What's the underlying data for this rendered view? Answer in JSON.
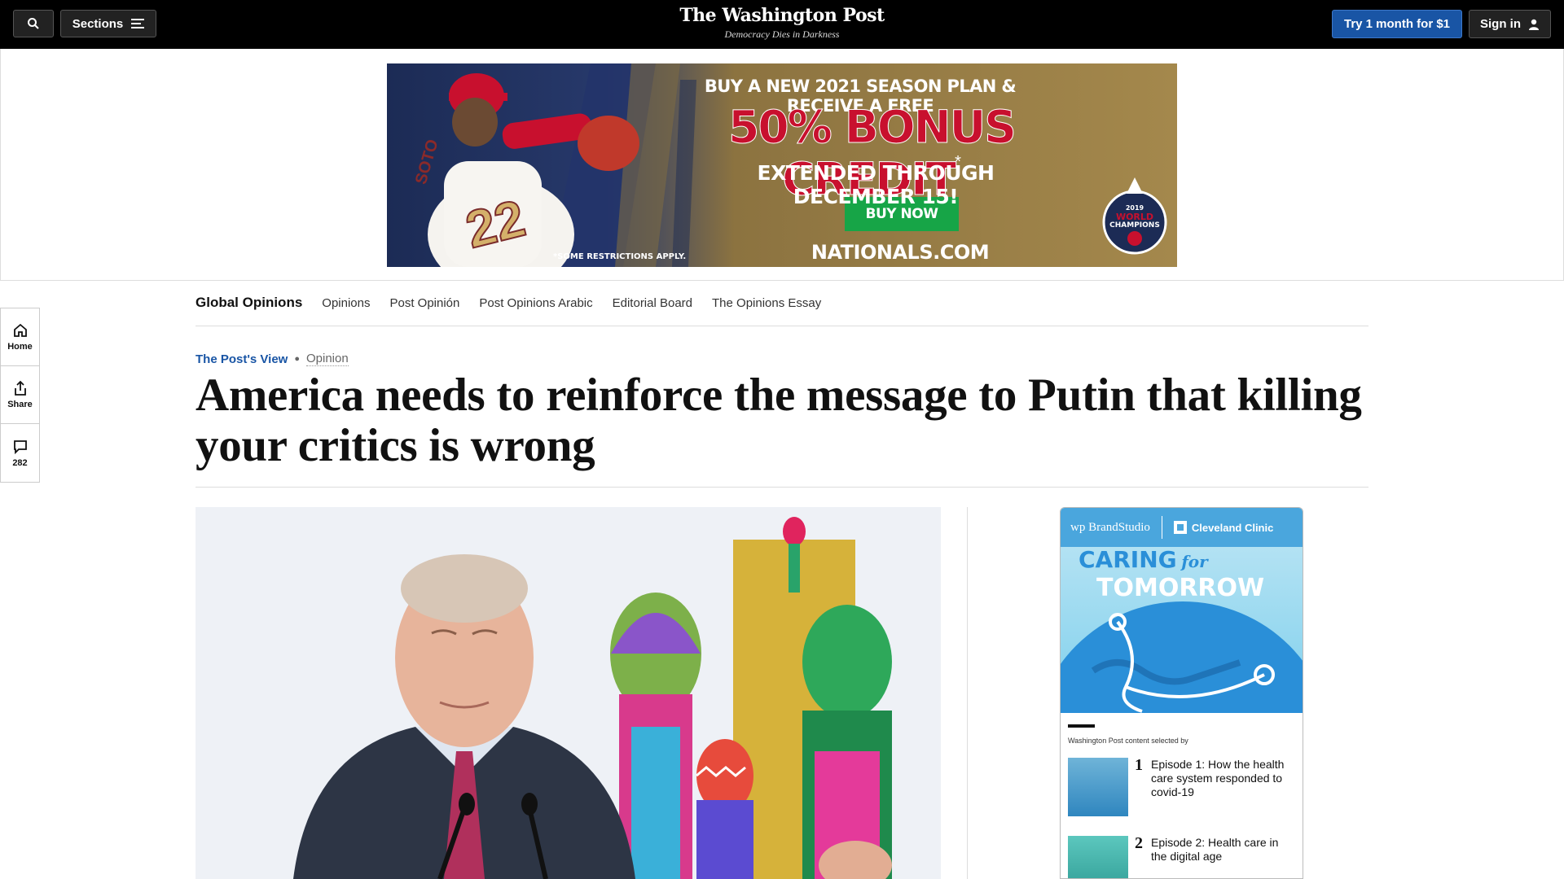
{
  "header": {
    "search_label": "",
    "sections_label": "Sections",
    "logo_name": "The Washington Post",
    "logo_tagline": "Democracy Dies in Darkness",
    "try_label": "Try 1 month for $1",
    "signin_label": "Sign in"
  },
  "ad": {
    "line1": "BUY A NEW 2021 SEASON PLAN & RECEIVE A FREE",
    "line2": "50% BONUS CREDIT",
    "line2_mark": "*",
    "line3": "EXTENDED THROUGH DECEMBER 15!",
    "cta": "BUY NOW",
    "site": "NATIONALS.COM",
    "fine": "*SOME RESTRICTIONS APPLY.",
    "jersey_name": "SOTO",
    "jersey_number": "22",
    "badge_year": "2019",
    "badge_line1": "WORLD",
    "badge_line2": "CHAMPIONS",
    "colors": {
      "navy": "#1c2b55",
      "gold": "#a4884c",
      "red": "#c8102e",
      "green": "#17a547"
    }
  },
  "subnav": {
    "items": [
      "Global Opinions",
      "Opinions",
      "Post Opinión",
      "Post Opinions Arabic",
      "Editorial Board",
      "The Opinions Essay"
    ]
  },
  "rail": {
    "home_label": "Home",
    "share_label": "Share",
    "comments_count": "282"
  },
  "article": {
    "kicker": "The Post's View",
    "section": "Opinion",
    "headline": "America needs to reinforce the message to Putin that killing your critics is wrong"
  },
  "brandstudio": {
    "wp_logo": "wp BrandStudio",
    "partner": "Cleveland Clinic",
    "title_line1": "CARING",
    "title_for": "for",
    "title_line2": "TOMORROW",
    "selected_by": "Washington Post content selected by",
    "episodes": [
      {
        "num": "1",
        "title": "Episode 1: How the health care system responded to covid-19"
      },
      {
        "num": "2",
        "title": "Episode 2: Health care in the digital age"
      }
    ]
  }
}
